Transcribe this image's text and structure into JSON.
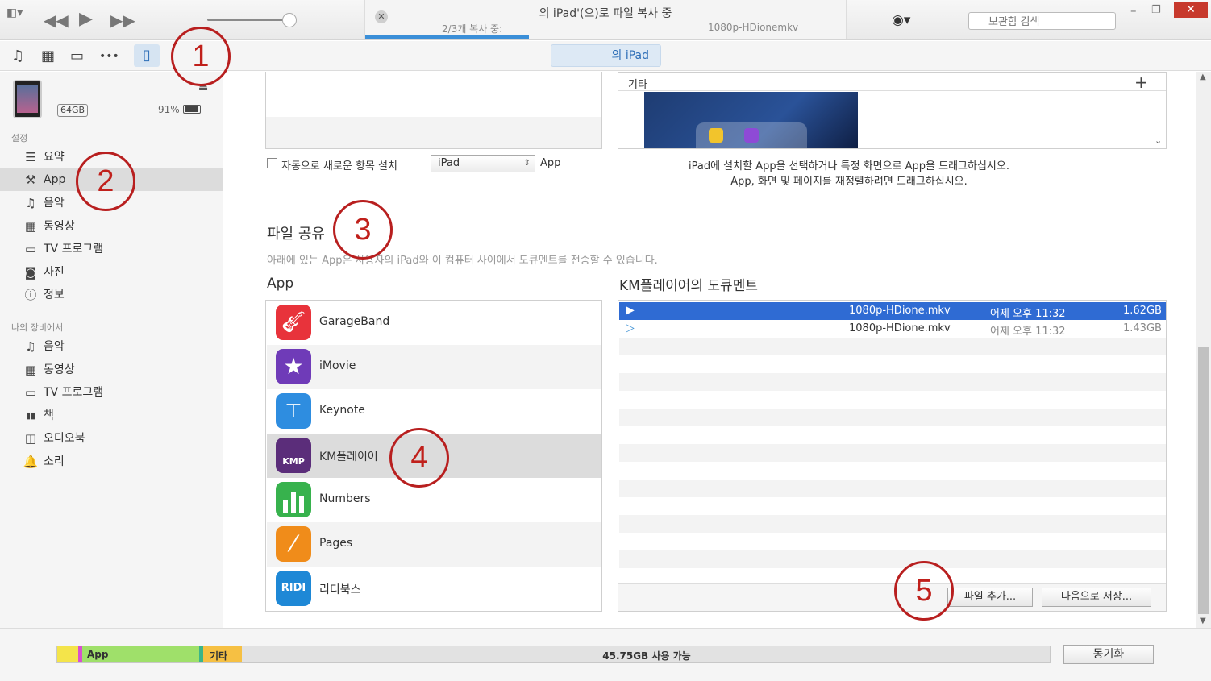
{
  "window": {
    "title": "의 iPad'(으)로 파일 복사 중",
    "progress_text": "2/3개 복사 중:",
    "progress_file": "1080p-HDionemkv",
    "progress_fraction": 0.34,
    "search_placeholder": "보관함 검색",
    "close_glyph": "✕",
    "min_glyph": "–",
    "max_glyph": "❐"
  },
  "player": {
    "rewind": "◀◀",
    "play": "▶",
    "forward": "▶▶",
    "volume_fraction": 0.92,
    "account_glyph": "👤"
  },
  "nav": {
    "icons": [
      "music-icon",
      "film-icon",
      "tv-icon",
      "more-icon",
      "device-icon"
    ],
    "icon_glyphs": [
      "♫",
      "▦",
      "▭",
      "•••",
      "▯"
    ],
    "device_tab": "의 iPad"
  },
  "device": {
    "capacity": "64GB",
    "battery": "91%",
    "eject": "⏏"
  },
  "sidebar": {
    "settings_header": "설정",
    "settings": [
      {
        "icon": "list-icon",
        "glyph": "☰",
        "label": "요약"
      },
      {
        "icon": "app-icon",
        "glyph": "⚒",
        "label": "App"
      },
      {
        "icon": "music-icon",
        "glyph": "♫",
        "label": "음악"
      },
      {
        "icon": "film-icon",
        "glyph": "▦",
        "label": "동영상"
      },
      {
        "icon": "tv-icon",
        "glyph": "▭",
        "label": "TV 프로그램"
      },
      {
        "icon": "camera-icon",
        "glyph": "◙",
        "label": "사진"
      },
      {
        "icon": "info-icon",
        "glyph": "ⓘ",
        "label": "정보"
      }
    ],
    "device_header": "나의 장비에서",
    "on_device": [
      {
        "icon": "music-icon",
        "glyph": "♫",
        "label": "음악"
      },
      {
        "icon": "film-icon",
        "glyph": "▦",
        "label": "동영상"
      },
      {
        "icon": "tv-icon",
        "glyph": "▭",
        "label": "TV 프로그램"
      },
      {
        "icon": "book-icon",
        "glyph": "▮▮",
        "label": "책"
      },
      {
        "icon": "audiobook-icon",
        "glyph": "◫",
        "label": "오디오북"
      },
      {
        "icon": "bell-icon",
        "glyph": "🔔",
        "label": "소리"
      }
    ]
  },
  "apps_top": {
    "auto_install_label": "자동으로 새로운 항목 설치",
    "device_select": "iPad",
    "app_suffix": "App",
    "other_label": "기타",
    "plus": "+",
    "hint_line1": "iPad에 설치할 App을 선택하거나 특정 화면으로 App을 드래그하십시오.",
    "hint_line2": "App, 화면 및 페이지를 재정렬하려면 드래그하십시오."
  },
  "file_sharing": {
    "title": "파일 공유",
    "description": "아래에 있는 App은 사용자의 iPad와 이 컴퓨터 사이에서 도큐멘트를 전송할 수 있습니다.",
    "apps_header": "App",
    "docs_header": "KM플레이어의 도큐멘트",
    "apps": [
      {
        "name": "GarageBand",
        "icon": "garageband-icon",
        "color": "#e8333b"
      },
      {
        "name": "iMovie",
        "icon": "imovie-icon",
        "color": "#6f3bb8"
      },
      {
        "name": "Keynote",
        "icon": "keynote-icon",
        "color": "#2e8de0"
      },
      {
        "name": "KM플레이어",
        "icon": "kmplayer-icon",
        "color": "#5b2d7a"
      },
      {
        "name": "Numbers",
        "icon": "numbers-icon",
        "color": "#37b24d"
      },
      {
        "name": "Pages",
        "icon": "pages-icon",
        "color": "#f08c1a"
      },
      {
        "name": "리디북스",
        "icon": "ridibooks-icon",
        "color": "#1e88d6"
      }
    ],
    "documents": [
      {
        "name": "1080p-HDione.mkv",
        "date": "어제 오후 11:32",
        "size": "1.62GB",
        "selected": true
      },
      {
        "name": "1080p-HDione.mkv",
        "date": "어제 오후 11:32",
        "size": "1.43GB",
        "selected": false
      }
    ],
    "add_button": "파일 추가...",
    "save_button": "다음으로 저장..."
  },
  "annotations": [
    "1",
    "2",
    "3",
    "4",
    "5"
  ],
  "storage": {
    "app_label": "App",
    "other_label": "기타",
    "free_label": "45.75GB 사용 가능",
    "sync_button": "동기화"
  }
}
